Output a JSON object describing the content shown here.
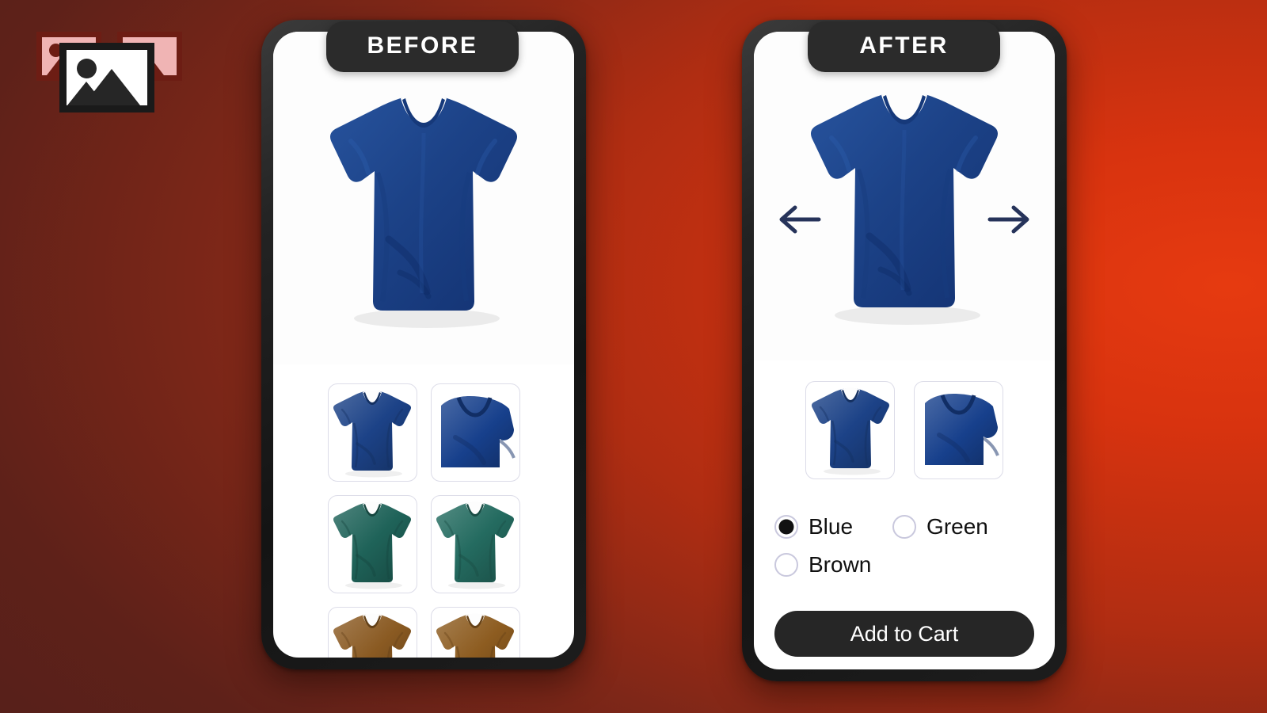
{
  "logo": {
    "name": "image-gallery-logo",
    "back_icon_fill": "#f0b4b4",
    "back_icon_border": "#6d1d14",
    "front_icon_fill": "#ffffff",
    "front_icon_border": "#1a1a1a"
  },
  "background": {
    "gradient_from": "#56201a",
    "gradient_to": "#e63a10"
  },
  "panels": {
    "before": {
      "badge": "BEFORE",
      "hero": {
        "alt": "royal-blue-tshirt",
        "color": "#1c4287"
      },
      "thumbnails": [
        {
          "alt": "blue-tshirt-front",
          "color": "#1c4287",
          "style": "full",
          "selected": false
        },
        {
          "alt": "blue-tshirt-closeup",
          "color": "#17408c",
          "style": "crop",
          "selected": false
        },
        {
          "alt": "green-tshirt-front",
          "color": "#1f6359",
          "style": "full",
          "selected": false
        },
        {
          "alt": "green-tshirt-angled",
          "color": "#246b60",
          "style": "full",
          "selected": false
        },
        {
          "alt": "brown-tshirt-front",
          "color": "#8a5a22",
          "style": "full",
          "selected": false
        },
        {
          "alt": "brown-tshirt-angled",
          "color": "#8d5c20",
          "style": "full",
          "selected": false
        }
      ]
    },
    "after": {
      "badge": "AFTER",
      "hero": {
        "alt": "royal-blue-tshirt",
        "color": "#1c4287"
      },
      "nav": {
        "prev_icon": "arrow-left-icon",
        "next_icon": "arrow-right-icon",
        "color": "#26335a"
      },
      "thumbnails": [
        {
          "alt": "blue-tshirt-front",
          "color": "#1c4287",
          "style": "full",
          "selected": false
        },
        {
          "alt": "blue-tshirt-closeup",
          "color": "#17408c",
          "style": "crop",
          "selected": false
        }
      ],
      "options": {
        "group_name": "color",
        "items": [
          {
            "label": "Blue",
            "value": "blue",
            "checked": true
          },
          {
            "label": "Green",
            "value": "green",
            "checked": false
          },
          {
            "label": "Brown",
            "value": "brown",
            "checked": false
          }
        ]
      },
      "cta": {
        "label": "Add to Cart",
        "background": "#262626",
        "text_color": "#ffffff"
      }
    }
  }
}
